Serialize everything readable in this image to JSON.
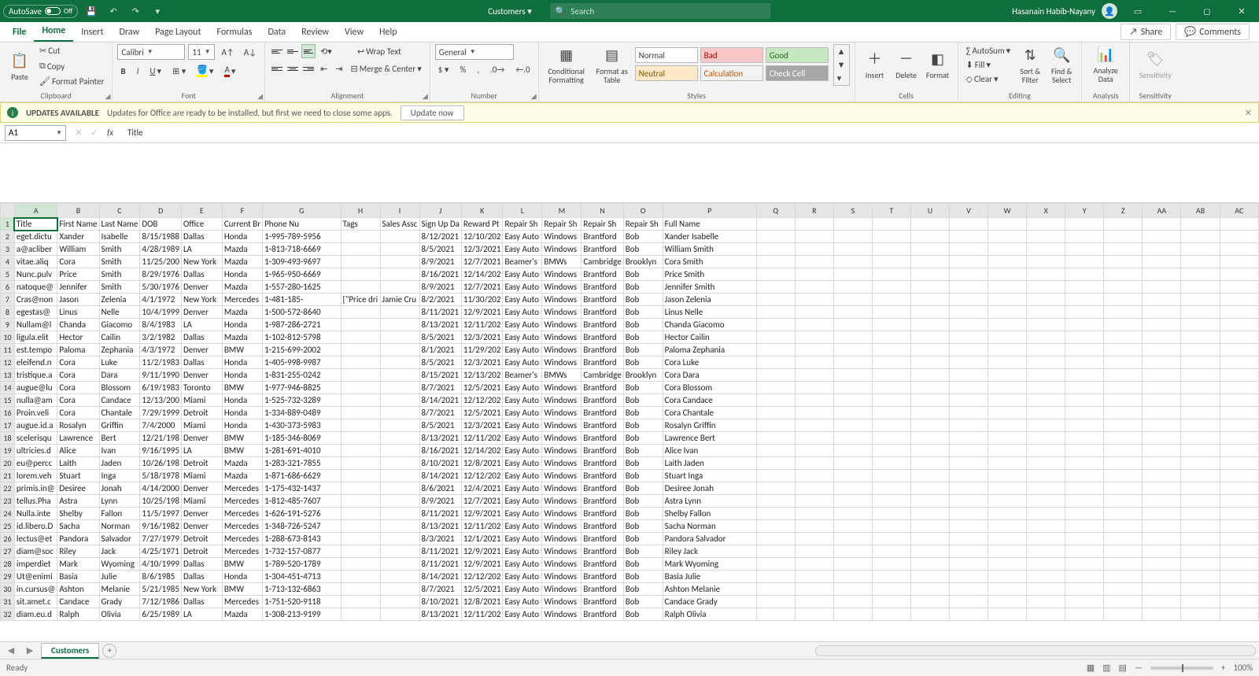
{
  "title": {
    "autosave": "AutoSave",
    "autosave_state": "Off",
    "doc_name": "Customers",
    "search_placeholder": "Search",
    "user": "Hasanain Habib-Nayany"
  },
  "menu": {
    "tabs": [
      "File",
      "Home",
      "Insert",
      "Draw",
      "Page Layout",
      "Formulas",
      "Data",
      "Review",
      "View",
      "Help"
    ],
    "share": "Share",
    "comments": "Comments"
  },
  "ribbon": {
    "clipboard": {
      "paste": "Paste",
      "cut": "Cut",
      "copy": "Copy",
      "painter": "Format Painter",
      "title": "Clipboard"
    },
    "font": {
      "name": "Calibri",
      "size": "11",
      "title": "Font"
    },
    "alignment": {
      "wrap": "Wrap Text",
      "merge": "Merge & Center",
      "title": "Alignment"
    },
    "number": {
      "format": "General",
      "title": "Number"
    },
    "styles": {
      "cond": "Conditional Formatting",
      "fat": "Format as Table",
      "cells": [
        "Normal",
        "Bad",
        "Good",
        "Neutral",
        "Calculation",
        "Check Cell"
      ],
      "title": "Styles"
    },
    "cells": {
      "insert": "Insert",
      "delete": "Delete",
      "format": "Format",
      "title": "Cells"
    },
    "editing": {
      "autosum": "AutoSum",
      "fill": "Fill",
      "clear": "Clear",
      "sort": "Sort & Filter",
      "find": "Find & Select",
      "title": "Editing"
    },
    "analysis": {
      "analyze": "Analyze Data",
      "title": "Analysis"
    },
    "sensitivity": {
      "label": "Sensitivity",
      "title": "Sensitivity"
    }
  },
  "msgbar": {
    "title": "UPDATES AVAILABLE",
    "text": "Updates for Office are ready to be installed, but first we need to close some apps.",
    "btn": "Update now"
  },
  "fbar": {
    "name": "A1",
    "value": "Title"
  },
  "sheet": {
    "name": "Customers",
    "ready": "Ready",
    "zoom": "100%"
  },
  "headers": [
    "Title",
    "First Name",
    "Last Name",
    "DOB",
    "Office",
    "Current Br",
    "Phone Nu",
    "Tags",
    "Sales Assc",
    "Sign Up Da",
    "Reward Pt",
    "Repair Sh",
    "Repair Sh",
    "Repair Sh",
    "Repair Sh",
    "Full Name"
  ],
  "rows": [
    [
      "eget.dictu",
      "Xander",
      "Isabelle",
      "8/15/1988",
      "Dallas",
      "Honda",
      "1-995-789-5956",
      "",
      "",
      "8/12/2021",
      "12/10/202",
      "Easy Auto",
      "Windows",
      "Brantford",
      "Bob",
      "Xander Isabelle"
    ],
    [
      "a@acliber",
      "William",
      "Smith",
      "4/28/1989",
      "LA",
      "Mazda",
      "1-813-718-6669",
      "",
      "",
      "8/5/2021",
      "12/3/2021",
      "Easy Auto",
      "Windows",
      "Brantford",
      "Bob",
      "William Smith"
    ],
    [
      "vitae.aliq",
      "Cora",
      "Smith",
      "11/25/200",
      "New York",
      "Mazda",
      "1-309-493-9697",
      "",
      "",
      "8/9/2021",
      "12/7/2021",
      "Beamer's",
      "BMWs",
      "Cambridge",
      "Brooklyn",
      "Cora Smith"
    ],
    [
      "Nunc.pulv",
      "Price",
      "Smith",
      "8/29/1976",
      "Dallas",
      "Honda",
      "1-965-950-6669",
      "",
      "",
      "8/16/2021",
      "12/14/202",
      "Easy Auto",
      "Windows",
      "Brantford",
      "Bob",
      "Price Smith"
    ],
    [
      "natoque@",
      "Jennifer",
      "Smith",
      "5/30/1976",
      "Denver",
      "Mazda",
      "1-557-280-1625",
      "",
      "",
      "8/9/2021",
      "12/7/2021",
      "Easy Auto",
      "Windows",
      "Brantford",
      "Bob",
      "Jennifer Smith"
    ],
    [
      "Cras@non",
      "Jason",
      "Zelenia",
      "4/1/1972",
      "New York",
      "Mercedes",
      "1-481-185-",
      "[\"Price dri",
      "Jamie Cru",
      "8/2/2021",
      "11/30/202",
      "Easy Auto",
      "Windows",
      "Brantford",
      "Bob",
      "Jason Zelenia"
    ],
    [
      "egestas@",
      "Linus",
      "Nelle",
      "10/4/1999",
      "Denver",
      "Mazda",
      "1-500-572-8640",
      "",
      "",
      "8/11/2021",
      "12/9/2021",
      "Easy Auto",
      "Windows",
      "Brantford",
      "Bob",
      "Linus Nelle"
    ],
    [
      "Nullam@l",
      "Chanda",
      "Giacomo",
      "8/4/1983",
      "LA",
      "Honda",
      "1-987-286-2721",
      "",
      "",
      "8/13/2021",
      "12/11/202",
      "Easy Auto",
      "Windows",
      "Brantford",
      "Bob",
      "Chanda Giacomo"
    ],
    [
      "ligula.elit",
      "Hector",
      "Cailin",
      "3/2/1982",
      "Dallas",
      "Mazda",
      "1-102-812-5798",
      "",
      "",
      "8/5/2021",
      "12/3/2021",
      "Easy Auto",
      "Windows",
      "Brantford",
      "Bob",
      "Hector Cailin"
    ],
    [
      "est.tempo",
      "Paloma",
      "Zephania",
      "4/3/1972",
      "Denver",
      "BMW",
      "1-215-699-2002",
      "",
      "",
      "8/1/2021",
      "11/29/202",
      "Easy Auto",
      "Windows",
      "Brantford",
      "Bob",
      "Paloma Zephania"
    ],
    [
      "eleifend.n",
      "Cora",
      "Luke",
      "11/2/1983",
      "Dallas",
      "Honda",
      "1-405-998-9987",
      "",
      "",
      "8/5/2021",
      "12/3/2021",
      "Easy Auto",
      "Windows",
      "Brantford",
      "Bob",
      "Cora Luke"
    ],
    [
      "tristique.a",
      "Cora",
      "Dara",
      "9/11/1990",
      "Denver",
      "Honda",
      "1-831-255-0242",
      "",
      "",
      "8/15/2021",
      "12/13/202",
      "Beamer's",
      "BMWs",
      "Cambridge",
      "Brooklyn",
      "Cora Dara"
    ],
    [
      "augue@lu",
      "Cora",
      "Blossom",
      "6/19/1983",
      "Toronto",
      "BMW",
      "1-977-946-8825",
      "",
      "",
      "8/7/2021",
      "12/5/2021",
      "Easy Auto",
      "Windows",
      "Brantford",
      "Bob",
      "Cora Blossom"
    ],
    [
      "nulla@am",
      "Cora",
      "Candace",
      "12/13/200",
      "Miami",
      "Honda",
      "1-525-732-3289",
      "",
      "",
      "8/14/2021",
      "12/12/202",
      "Easy Auto",
      "Windows",
      "Brantford",
      "Bob",
      "Cora Candace"
    ],
    [
      "Proin.veli",
      "Cora",
      "Chantale",
      "7/29/1999",
      "Detroit",
      "Honda",
      "1-334-889-0489",
      "",
      "",
      "8/7/2021",
      "12/5/2021",
      "Easy Auto",
      "Windows",
      "Brantford",
      "Bob",
      "Cora Chantale"
    ],
    [
      "augue.id.a",
      "Rosalyn",
      "Griffin",
      "7/4/2000",
      "Miami",
      "Honda",
      "1-430-373-5983",
      "",
      "",
      "8/5/2021",
      "12/3/2021",
      "Easy Auto",
      "Windows",
      "Brantford",
      "Bob",
      "Rosalyn Griffin"
    ],
    [
      "scelerisqu",
      "Lawrence",
      "Bert",
      "12/21/198",
      "Denver",
      "BMW",
      "1-185-346-8069",
      "",
      "",
      "8/13/2021",
      "12/11/202",
      "Easy Auto",
      "Windows",
      "Brantford",
      "Bob",
      "Lawrence Bert"
    ],
    [
      "ultricies.d",
      "Alice",
      "Ivan",
      "9/16/1995",
      "LA",
      "BMW",
      "1-281-691-4010",
      "",
      "",
      "8/16/2021",
      "12/14/202",
      "Easy Auto",
      "Windows",
      "Brantford",
      "Bob",
      "Alice Ivan"
    ],
    [
      "eu@percc",
      "Laith",
      "Jaden",
      "10/26/198",
      "Detroit",
      "Mazda",
      "1-283-321-7855",
      "",
      "",
      "8/10/2021",
      "12/8/2021",
      "Easy Auto",
      "Windows",
      "Brantford",
      "Bob",
      "Laith Jaden"
    ],
    [
      "lorem.veh",
      "Stuart",
      "Inga",
      "5/18/1978",
      "Miami",
      "Mazda",
      "1-871-686-6629",
      "",
      "",
      "8/14/2021",
      "12/12/202",
      "Easy Auto",
      "Windows",
      "Brantford",
      "Bob",
      "Stuart Inga"
    ],
    [
      "primis.in@",
      "Desiree",
      "Jonah",
      "4/14/2000",
      "Denver",
      "Mercedes",
      "1-175-432-1437",
      "",
      "",
      "8/6/2021",
      "12/4/2021",
      "Easy Auto",
      "Windows",
      "Brantford",
      "Bob",
      "Desiree Jonah"
    ],
    [
      "tellus.Pha",
      "Astra",
      "Lynn",
      "10/25/198",
      "Miami",
      "Mercedes",
      "1-812-485-7607",
      "",
      "",
      "8/9/2021",
      "12/7/2021",
      "Easy Auto",
      "Windows",
      "Brantford",
      "Bob",
      "Astra Lynn"
    ],
    [
      "Nulla.inte",
      "Shelby",
      "Fallon",
      "11/5/1997",
      "Denver",
      "Mercedes",
      "1-626-191-5276",
      "",
      "",
      "8/11/2021",
      "12/9/2021",
      "Easy Auto",
      "Windows",
      "Brantford",
      "Bob",
      "Shelby Fallon"
    ],
    [
      "id.libero.D",
      "Sacha",
      "Norman",
      "9/16/1982",
      "Denver",
      "Mercedes",
      "1-348-726-5247",
      "",
      "",
      "8/13/2021",
      "12/11/202",
      "Easy Auto",
      "Windows",
      "Brantford",
      "Bob",
      "Sacha Norman"
    ],
    [
      "lectus@et",
      "Pandora",
      "Salvador",
      "7/27/1979",
      "Detroit",
      "Mercedes",
      "1-288-673-8143",
      "",
      "",
      "8/3/2021",
      "12/1/2021",
      "Easy Auto",
      "Windows",
      "Brantford",
      "Bob",
      "Pandora Salvador"
    ],
    [
      "diam@soc",
      "Riley",
      "Jack",
      "4/25/1971",
      "Detroit",
      "Mercedes",
      "1-732-157-0877",
      "",
      "",
      "8/11/2021",
      "12/9/2021",
      "Easy Auto",
      "Windows",
      "Brantford",
      "Bob",
      "Riley Jack"
    ],
    [
      "imperdiet",
      "Mark",
      "Wyoming",
      "4/10/1999",
      "Dallas",
      "BMW",
      "1-789-520-1789",
      "",
      "",
      "8/11/2021",
      "12/9/2021",
      "Easy Auto",
      "Windows",
      "Brantford",
      "Bob",
      "Mark Wyoming"
    ],
    [
      "Ut@enimi",
      "Basia",
      "Julie",
      "8/6/1985",
      "Dallas",
      "Honda",
      "1-304-451-4713",
      "",
      "",
      "8/14/2021",
      "12/12/202",
      "Easy Auto",
      "Windows",
      "Brantford",
      "Bob",
      "Basia Julie"
    ],
    [
      "in.cursus@",
      "Ashton",
      "Melanie",
      "5/21/1985",
      "New York",
      "BMW",
      "1-713-132-6863",
      "",
      "",
      "8/7/2021",
      "12/5/2021",
      "Easy Auto",
      "Windows",
      "Brantford",
      "Bob",
      "Ashton Melanie"
    ],
    [
      "sit.amet.c",
      "Candace",
      "Grady",
      "7/12/1986",
      "Dallas",
      "Mercedes",
      "1-751-520-9118",
      "",
      "",
      "8/10/2021",
      "12/8/2021",
      "Easy Auto",
      "Windows",
      "Brantford",
      "Bob",
      "Candace Grady"
    ],
    [
      "diam.eu.d",
      "Ralph",
      "Olivia",
      "6/25/1989",
      "LA",
      "Mazda",
      "1-308-213-9199",
      "",
      "",
      "8/13/2021",
      "12/11/202",
      "Easy Auto",
      "Windows",
      "Brantford",
      "Bob",
      "Ralph Olivia"
    ]
  ],
  "extraCols": [
    "Q",
    "R",
    "S",
    "T",
    "U",
    "V",
    "W",
    "X",
    "Y",
    "Z",
    "AA",
    "AB",
    "AC"
  ]
}
